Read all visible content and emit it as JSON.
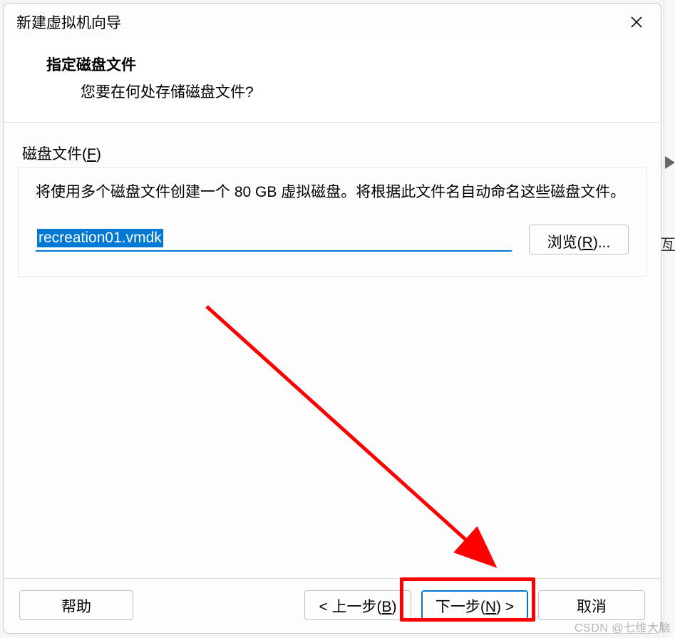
{
  "dialog": {
    "title": "新建虚拟机向导",
    "header": {
      "title": "指定磁盘文件",
      "subtitle": "您要在何处存储磁盘文件?"
    },
    "group_label_prefix": "磁盘文件(",
    "group_label_mnemonic": "F",
    "group_label_suffix": ")",
    "description": "将使用多个磁盘文件创建一个 80 GB 虚拟磁盘。将根据此文件名自动命名这些磁盘文件。",
    "file_value": "recreation01.vmdk",
    "browse_prefix": "浏览(",
    "browse_mnemonic": "R",
    "browse_suffix": ")...",
    "buttons": {
      "help": "帮助",
      "back_prefix": "< 上一步(",
      "back_mnemonic": "B",
      "back_suffix": ")",
      "next_prefix": "下一步(",
      "next_mnemonic": "N",
      "next_suffix": ") >",
      "cancel": "取消"
    }
  },
  "watermark": "CSDN @七维大脑",
  "side_char": "亙"
}
